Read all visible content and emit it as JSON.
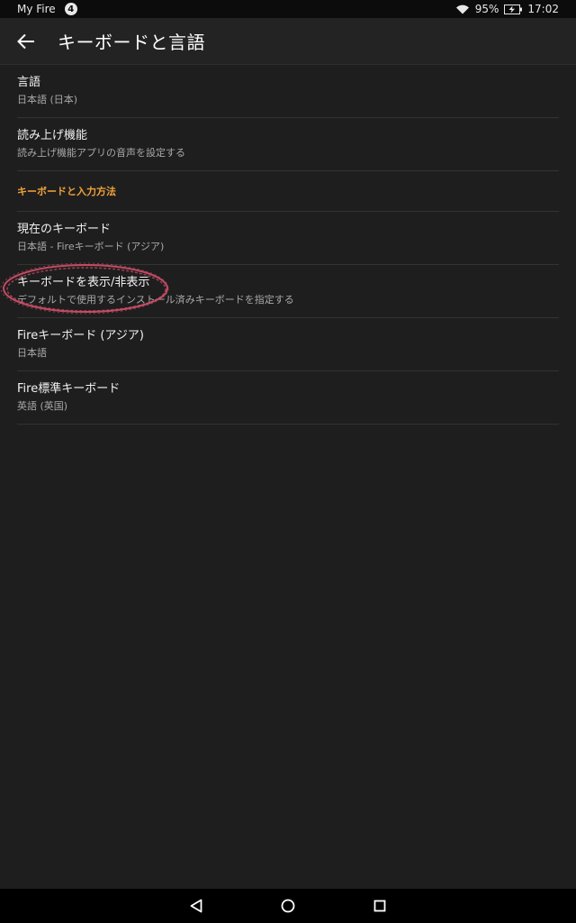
{
  "status_bar": {
    "app_name": "My Fire",
    "notification_count": "4",
    "battery": "95%",
    "time": "17:02"
  },
  "header": {
    "title": "キーボードと言語",
    "back_icon": "back-arrow-icon"
  },
  "settings": {
    "items": [
      {
        "title": "言語",
        "subtitle": "日本語 (日本)"
      },
      {
        "title": "読み上げ機能",
        "subtitle": "読み上げ機能アプリの音声を設定する"
      }
    ],
    "section_header": "キーボードと入力方法",
    "keyboard_items": [
      {
        "title": "現在のキーボード",
        "subtitle": "日本語 - Fireキーボード (アジア)"
      },
      {
        "title": "キーボードを表示/非表示",
        "subtitle": "デフォルトで使用するインストール済みキーボードを指定する"
      },
      {
        "title": "Fireキーボード (アジア)",
        "subtitle": "日本語"
      },
      {
        "title": "Fire標準キーボード",
        "subtitle": "英語 (英国)"
      }
    ]
  },
  "nav_bar": {
    "back_icon": "triangle-back-icon",
    "home_icon": "circle-home-icon",
    "recents_icon": "square-recents-icon"
  },
  "colors": {
    "background": "#1e1e1e",
    "app_bar": "#232323",
    "section_accent": "#f0a23b",
    "annotation": "#d0506a"
  }
}
